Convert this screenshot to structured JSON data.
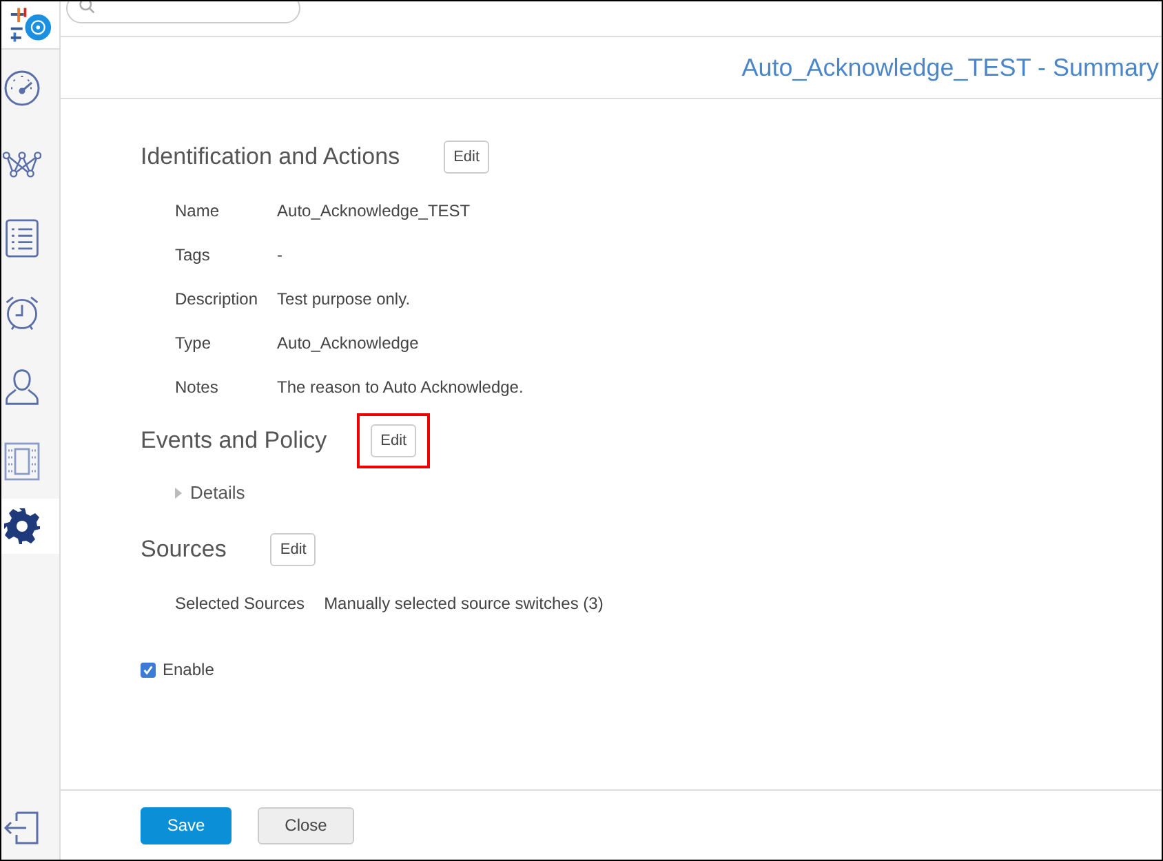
{
  "nav": [
    {
      "kind": "gauge",
      "selected": false
    },
    {
      "kind": "network",
      "selected": false
    },
    {
      "kind": "list",
      "selected": false
    },
    {
      "kind": "alarm",
      "selected": false
    },
    {
      "kind": "person",
      "selected": false
    },
    {
      "kind": "grid",
      "selected": false
    },
    {
      "kind": "gear",
      "selected": true
    }
  ],
  "page_title": "Auto_Acknowledge_TEST - Summary",
  "sections": [
    {
      "title": "Identification and Actions",
      "edit": "Edit",
      "highlighted": false,
      "kind": "fields",
      "fields": [
        {
          "label": "Name",
          "value": "Auto_Acknowledge_TEST"
        },
        {
          "label": "Tags",
          "value": "-"
        },
        {
          "label": "Description",
          "value": "Test purpose only."
        },
        {
          "label": "Type",
          "value": "Auto_Acknowledge"
        },
        {
          "label": "Notes",
          "value": "The reason to Auto Acknowledge."
        }
      ]
    },
    {
      "title": "Events and Policy",
      "edit": "Edit",
      "highlighted": true,
      "kind": "expander",
      "expander": {
        "label": "Details",
        "expanded": false
      }
    },
    {
      "title": "Sources",
      "edit": "Edit",
      "highlighted": false,
      "kind": "fields",
      "fields": [
        {
          "label": "Selected Sources",
          "value": "Manually selected source switches (3)"
        }
      ]
    }
  ],
  "enable": {
    "label": "Enable",
    "checked": true
  },
  "buttons": [
    {
      "label": "Save",
      "kind": "primary"
    },
    {
      "label": "Close",
      "kind": "secondary"
    }
  ]
}
